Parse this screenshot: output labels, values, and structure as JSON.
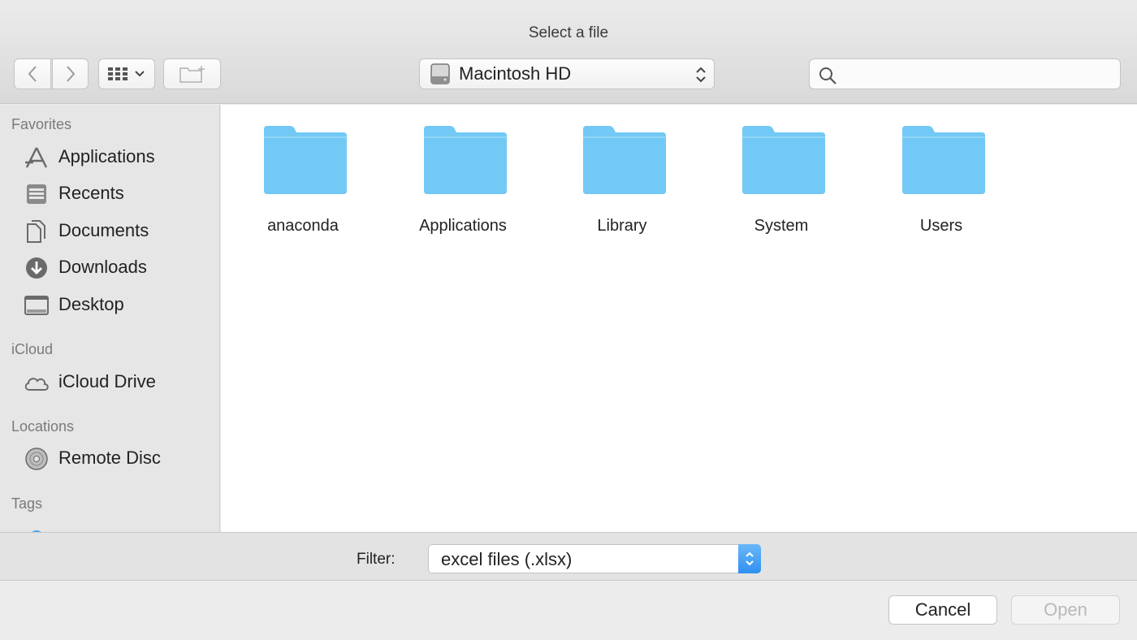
{
  "window": {
    "title": "Select a file"
  },
  "toolbar": {
    "location_label": "Macintosh HD",
    "search_placeholder": ""
  },
  "sidebar": {
    "sections": {
      "favorites": "Favorites",
      "icloud": "iCloud",
      "locations": "Locations",
      "tags": "Tags"
    },
    "items": [
      {
        "label": "Applications",
        "icon": "applications-icon"
      },
      {
        "label": "Recents",
        "icon": "recents-icon"
      },
      {
        "label": "Documents",
        "icon": "documents-icon"
      },
      {
        "label": "Downloads",
        "icon": "downloads-icon"
      },
      {
        "label": "Desktop",
        "icon": "desktop-icon"
      },
      {
        "label": "iCloud Drive",
        "icon": "icloud-icon"
      },
      {
        "label": "Remote Disc",
        "icon": "disc-icon"
      }
    ]
  },
  "content": {
    "folders": [
      "anaconda",
      "Applications",
      "Library",
      "System",
      "Users"
    ]
  },
  "filter": {
    "label": "Filter:",
    "value": "excel files (.xlsx)"
  },
  "buttons": {
    "cancel": "Cancel",
    "open": "Open"
  },
  "colors": {
    "folder": "#73c9f5",
    "accent": "#2f8ff0"
  }
}
